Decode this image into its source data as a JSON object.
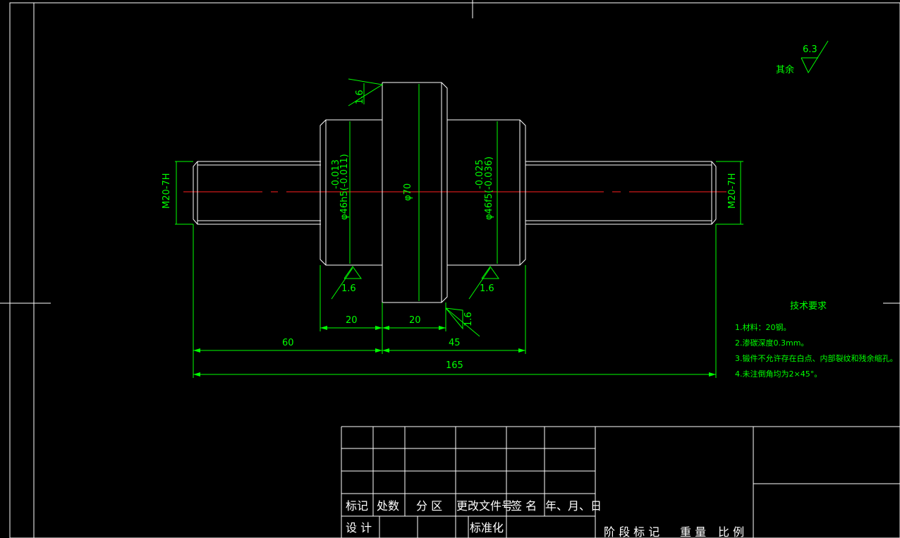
{
  "surface_finish": {
    "other_label": "其余",
    "other_value": "6.3",
    "shaft_left_face": "1.6",
    "shaft_right_face": "1.6",
    "collar_left_top": "1.6",
    "collar_right_bottom": "1.6"
  },
  "dimensions": {
    "thread_left": "M20-7H",
    "thread_right": "M20-7H",
    "dia_left": "φ46h5(-0.011)",
    "dia_left_tol": "-0.013",
    "dia_center": "φ70",
    "dia_right": "φ46f5(-0.036)",
    "dia_right_tol": "-0.025",
    "len_left_journal": "20",
    "len_collar": "20",
    "len_left_total": "60",
    "len_right": "45",
    "len_overall": "165"
  },
  "tech_requirements": {
    "title": "技术要求",
    "items": [
      "1.材料：20钢。",
      "2.渗碳深度0.3mm。",
      "3.锻件不允许存在白点、内部裂纹和残余缩孔。",
      "4.未注倒角均为2×45°。"
    ]
  },
  "title_block": {
    "headers": [
      "标记",
      "处数",
      "分 区",
      "更改文件号",
      "签 名",
      "年、月、日"
    ],
    "design": "设 计",
    "standardize": "标准化",
    "stage_mark": "阶 段 标 记",
    "weight": "重 量",
    "scale": "比 例"
  }
}
